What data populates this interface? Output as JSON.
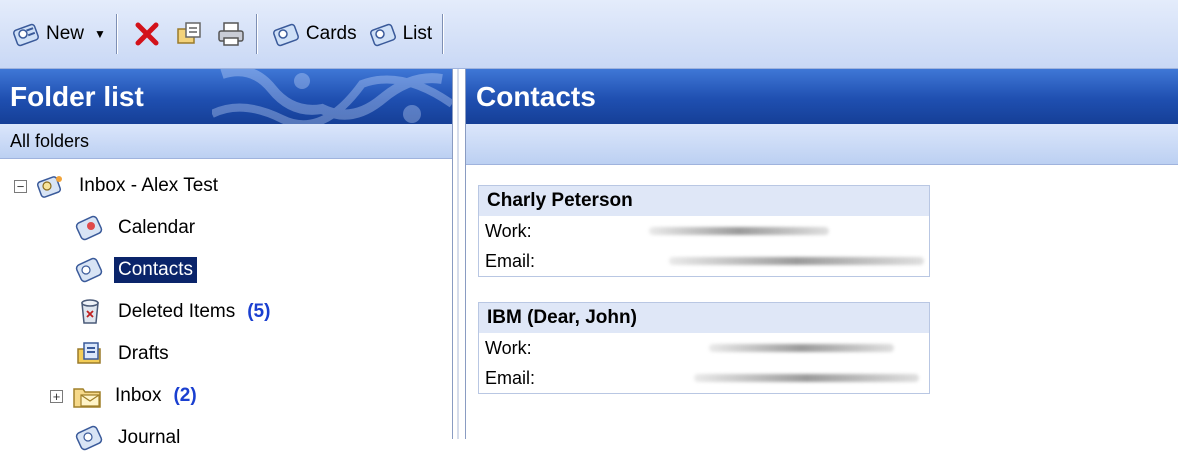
{
  "toolbar": {
    "new_label": "New",
    "cards_label": "Cards",
    "list_label": "List",
    "icons": [
      "contacts-icon",
      "chevron-down-icon",
      "delete-icon",
      "move-icon",
      "print-icon",
      "cards-icon",
      "list-icon"
    ]
  },
  "folder_pane": {
    "title": "Folder list",
    "subtitle": "All folders",
    "tree": [
      {
        "label": "Inbox - Alex Test",
        "icon": "mailbox-root-icon",
        "expander": "−"
      },
      {
        "label": "Calendar",
        "icon": "calendar-icon"
      },
      {
        "label": "Contacts",
        "icon": "contacts-icon",
        "selected": true
      },
      {
        "label": "Deleted Items",
        "icon": "deleted-items-icon",
        "count": "(5)"
      },
      {
        "label": "Drafts",
        "icon": "drafts-icon"
      },
      {
        "label": "Inbox",
        "icon": "inbox-folder-icon",
        "count": "(2)",
        "expander": "+"
      },
      {
        "label": "Journal",
        "icon": "journal-icon"
      }
    ]
  },
  "contacts_pane": {
    "title": "Contacts",
    "cards": [
      {
        "name": "Charly Peterson",
        "work_label": "Work:",
        "email_label": "Email:"
      },
      {
        "name": "IBM (Dear, John)",
        "work_label": "Work:",
        "email_label": "Email:"
      }
    ]
  },
  "colors": {
    "header_blue": "#1f4fb0",
    "selection": "#0a246a",
    "count_blue": "#1a3fd0"
  }
}
